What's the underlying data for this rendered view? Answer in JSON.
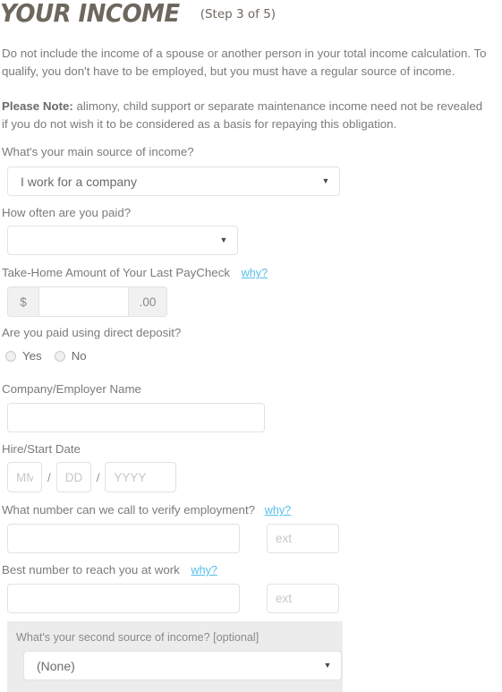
{
  "header": {
    "title": "YOUR INCOME",
    "step": "(Step 3 of 5)"
  },
  "intro": {
    "paragraph": "Do not include the income of a spouse or another person in your total income calculation. To qualify, you don't have to be employed, but you must have a regular source of income.",
    "note_bold": "Please Note:",
    "note_rest": " alimony, child support or separate maintenance income need not be revealed if you do not wish it to be considered as a basis for repaying this obligation."
  },
  "form": {
    "main_source": {
      "label": "What's your main source of income?",
      "value": "I work for a company",
      "caret": "▼"
    },
    "pay_frequency": {
      "label": "How often are you paid?",
      "value": "",
      "caret": "▼"
    },
    "take_home": {
      "label": "Take-Home Amount of Your Last PayCheck",
      "why": "why?",
      "prefix": "$",
      "suffix": ".00",
      "value": "",
      "placeholder": ""
    },
    "direct_deposit": {
      "label": "Are you paid using direct deposit?",
      "options": [
        {
          "label": "Yes",
          "selected": false
        },
        {
          "label": "No",
          "selected": false
        }
      ]
    },
    "employer": {
      "label": "Company/Employer Name",
      "value": "",
      "placeholder": ""
    },
    "hire_date": {
      "label": "Hire/Start Date",
      "month_placeholder": "MM",
      "day_placeholder": "DD",
      "year_placeholder": "YYYY",
      "separator": "/",
      "month_value": "",
      "day_value": "",
      "year_value": ""
    },
    "verify_phone": {
      "label": "What number can we call to verify employment?",
      "why": "why?",
      "value": "",
      "ext_placeholder": "ext",
      "ext_value": ""
    },
    "work_phone": {
      "label": "Best number to reach you at work",
      "why": "why?",
      "value": "",
      "ext_placeholder": "ext",
      "ext_value": ""
    },
    "second_source": {
      "label": "What's your second source of income? [optional]",
      "value": "(None)",
      "caret": "▼"
    }
  },
  "colors": {
    "title": "#6e675d",
    "body_text": "#7b7b7b",
    "link": "#55bdea",
    "border": "#e2e2e2",
    "panel_bg": "#ececec",
    "addon_bg": "#f1f1f1"
  }
}
